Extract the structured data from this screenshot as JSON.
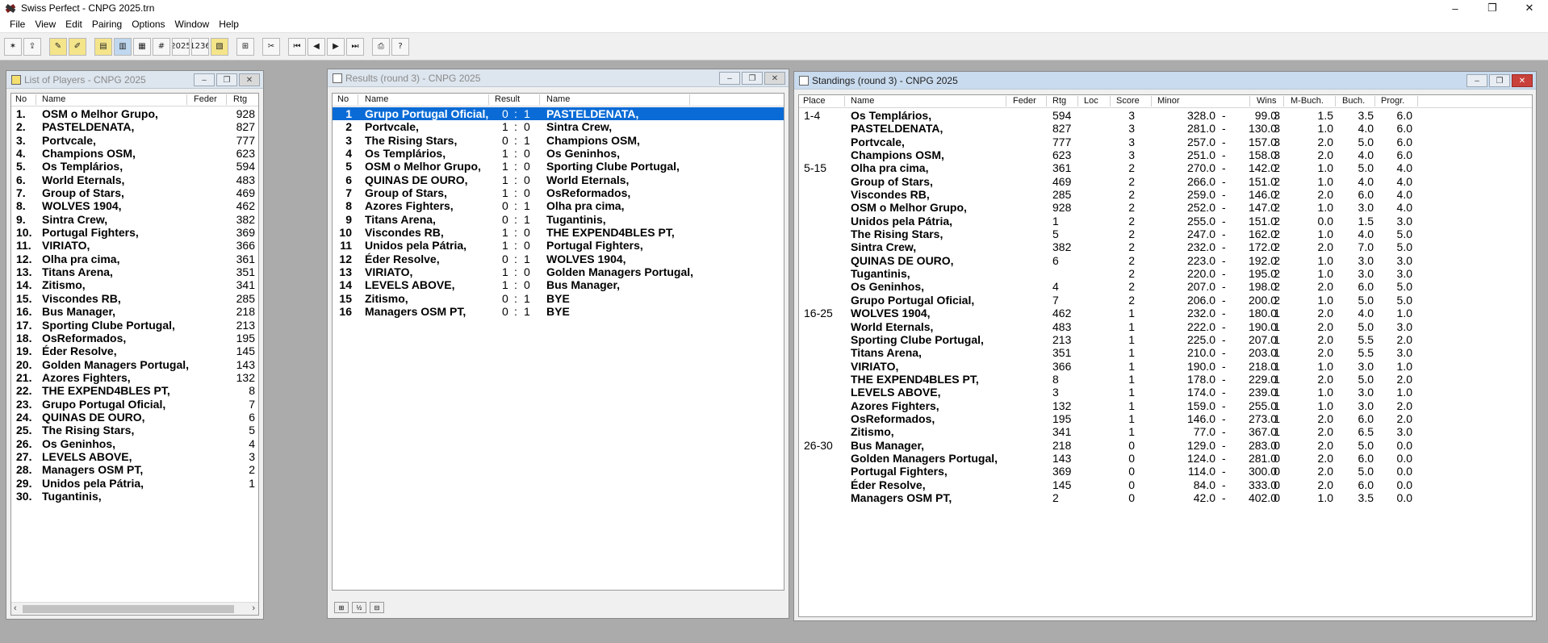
{
  "app": {
    "title": "Swiss Perfect - CNPG 2025.trn",
    "window_controls": [
      "–",
      "❐",
      "✕"
    ]
  },
  "menu": [
    "File",
    "View",
    "Edit",
    "Pairing",
    "Options",
    "Window",
    "Help"
  ],
  "toolbar": {
    "icons": [
      "new-tournament-icon",
      "open-tournament-icon",
      "sep",
      "edit-pen-icon",
      "edit-player-icon",
      "sep",
      "list-players-icon",
      "results-grid-icon",
      "grid-icon",
      "number-grid-icon",
      "year-2025-icon",
      "sort-1236-icon",
      "chart-icon",
      "sep",
      "table-icon",
      "sep",
      "scissors-icon",
      "sep",
      "first-round-icon",
      "prev-round-icon",
      "next-round-icon",
      "last-round-icon",
      "sep",
      "print-icon",
      "help-icon"
    ],
    "icon_glyphs": [
      "✶",
      "⇪",
      "",
      "✎",
      "✐",
      "",
      "▤",
      "▥",
      "▦",
      "#",
      "2025",
      "1236",
      "▧",
      "",
      "⊞",
      "",
      "✂",
      "",
      "⏮",
      "◀",
      "▶",
      "⏭",
      "",
      "⎙",
      "?"
    ]
  },
  "players_window": {
    "title": "List of Players - CNPG 2025",
    "headers": {
      "no": "No",
      "name": "Name",
      "feder": "Feder",
      "rtg": "Rtg"
    },
    "rows": [
      {
        "no": "1.",
        "name": "OSM o Melhor Grupo,",
        "rtg": "928"
      },
      {
        "no": "2.",
        "name": "PASTELDENATA,",
        "rtg": "827"
      },
      {
        "no": "3.",
        "name": "Portvcale,",
        "rtg": "777"
      },
      {
        "no": "4.",
        "name": "Champions OSM,",
        "rtg": "623"
      },
      {
        "no": "5.",
        "name": "Os Templários,",
        "rtg": "594"
      },
      {
        "no": "6.",
        "name": "World Eternals,",
        "rtg": "483"
      },
      {
        "no": "7.",
        "name": "Group of Stars,",
        "rtg": "469"
      },
      {
        "no": "8.",
        "name": "WOLVES 1904,",
        "rtg": "462"
      },
      {
        "no": "9.",
        "name": "Sintra Crew,",
        "rtg": "382"
      },
      {
        "no": "10.",
        "name": "Portugal Fighters,",
        "rtg": "369"
      },
      {
        "no": "11.",
        "name": "VIRIATO,",
        "rtg": "366"
      },
      {
        "no": "12.",
        "name": "Olha pra cima,",
        "rtg": "361"
      },
      {
        "no": "13.",
        "name": "Titans Arena,",
        "rtg": "351"
      },
      {
        "no": "14.",
        "name": "Zitismo,",
        "rtg": "341"
      },
      {
        "no": "15.",
        "name": "Viscondes RB,",
        "rtg": "285"
      },
      {
        "no": "16.",
        "name": "Bus Manager,",
        "rtg": "218"
      },
      {
        "no": "17.",
        "name": "Sporting Clube Portugal,",
        "rtg": "213"
      },
      {
        "no": "18.",
        "name": "OsReformados,",
        "rtg": "195"
      },
      {
        "no": "19.",
        "name": "Éder Resolve,",
        "rtg": "145"
      },
      {
        "no": "20.",
        "name": "Golden Managers Portugal,",
        "rtg": "143"
      },
      {
        "no": "21.",
        "name": "Azores Fighters,",
        "rtg": "132"
      },
      {
        "no": "22.",
        "name": "THE EXPEND4BLES PT,",
        "rtg": "8"
      },
      {
        "no": "23.",
        "name": "Grupo Portugal Oficial,",
        "rtg": "7"
      },
      {
        "no": "24.",
        "name": "QUINAS DE OURO,",
        "rtg": "6"
      },
      {
        "no": "25.",
        "name": "The Rising Stars,",
        "rtg": "5"
      },
      {
        "no": "26.",
        "name": "Os Geninhos,",
        "rtg": "4"
      },
      {
        "no": "27.",
        "name": "LEVELS ABOVE,",
        "rtg": "3"
      },
      {
        "no": "28.",
        "name": "Managers OSM PT,",
        "rtg": "2"
      },
      {
        "no": "29.",
        "name": "Unidos pela Pátria,",
        "rtg": "1"
      },
      {
        "no": "30.",
        "name": "Tugantinis,",
        "rtg": ""
      }
    ]
  },
  "results_window": {
    "title": "Results  (round 3) - CNPG 2025",
    "headers": {
      "no": "No",
      "name": "Name",
      "result": "Result",
      "name2": "Name"
    },
    "rows": [
      {
        "no": "1",
        "white": "Grupo Portugal Oficial,",
        "rw": "0",
        "rb": "1",
        "black": "PASTELDENATA,"
      },
      {
        "no": "2",
        "white": "Portvcale,",
        "rw": "1",
        "rb": "0",
        "black": "Sintra Crew,"
      },
      {
        "no": "3",
        "white": "The Rising Stars,",
        "rw": "0",
        "rb": "1",
        "black": "Champions OSM,"
      },
      {
        "no": "4",
        "white": "Os Templários,",
        "rw": "1",
        "rb": "0",
        "black": "Os Geninhos,"
      },
      {
        "no": "5",
        "white": "OSM o Melhor Grupo,",
        "rw": "1",
        "rb": "0",
        "black": "Sporting Clube Portugal,"
      },
      {
        "no": "6",
        "white": "QUINAS DE OURO,",
        "rw": "1",
        "rb": "0",
        "black": "World Eternals,"
      },
      {
        "no": "7",
        "white": "Group of Stars,",
        "rw": "1",
        "rb": "0",
        "black": "OsReformados,"
      },
      {
        "no": "8",
        "white": "Azores Fighters,",
        "rw": "0",
        "rb": "1",
        "black": "Olha pra cima,"
      },
      {
        "no": "9",
        "white": "Titans Arena,",
        "rw": "0",
        "rb": "1",
        "black": "Tugantinis,"
      },
      {
        "no": "10",
        "white": "Viscondes RB,",
        "rw": "1",
        "rb": "0",
        "black": "THE EXPEND4BLES PT,"
      },
      {
        "no": "11",
        "white": "Unidos pela Pátria,",
        "rw": "1",
        "rb": "0",
        "black": "Portugal Fighters,"
      },
      {
        "no": "12",
        "white": "Éder Resolve,",
        "rw": "0",
        "rb": "1",
        "black": "WOLVES 1904,"
      },
      {
        "no": "13",
        "white": "VIRIATO,",
        "rw": "1",
        "rb": "0",
        "black": "Golden Managers Portugal,"
      },
      {
        "no": "14",
        "white": "LEVELS ABOVE,",
        "rw": "1",
        "rb": "0",
        "black": "Bus Manager,"
      },
      {
        "no": "15",
        "white": "Zitismo,",
        "rw": "0",
        "rb": "1",
        "black": "BYE"
      },
      {
        "no": "16",
        "white": "Managers OSM PT,",
        "rw": "0",
        "rb": "1",
        "black": "BYE"
      }
    ],
    "bottom_buttons": [
      "⊞",
      "½",
      "⊟"
    ]
  },
  "standings_window": {
    "title": "Standings  (round 3) - CNPG 2025",
    "headers": {
      "place": "Place",
      "name": "Name",
      "feder": "Feder",
      "rtg": "Rtg",
      "loc": "Loc",
      "score": "Score",
      "minor": "Minor",
      "wins": "Wins",
      "mbuch": "M-Buch.",
      "buch": "Buch.",
      "progr": "Progr."
    },
    "rows": [
      {
        "place": "1-4",
        "name": "Os Templários,",
        "rtg": "594",
        "score": "3",
        "m1": "328.0",
        "m2": "99.0",
        "wins": "3",
        "mbuch": "1.5",
        "buch": "3.5",
        "progr": "6.0"
      },
      {
        "place": "",
        "name": "PASTELDENATA,",
        "rtg": "827",
        "score": "3",
        "m1": "281.0",
        "m2": "130.0",
        "wins": "3",
        "mbuch": "1.0",
        "buch": "4.0",
        "progr": "6.0"
      },
      {
        "place": "",
        "name": "Portvcale,",
        "rtg": "777",
        "score": "3",
        "m1": "257.0",
        "m2": "157.0",
        "wins": "3",
        "mbuch": "2.0",
        "buch": "5.0",
        "progr": "6.0"
      },
      {
        "place": "",
        "name": "Champions OSM,",
        "rtg": "623",
        "score": "3",
        "m1": "251.0",
        "m2": "158.0",
        "wins": "3",
        "mbuch": "2.0",
        "buch": "4.0",
        "progr": "6.0"
      },
      {
        "place": "5-15",
        "name": "Olha pra cima,",
        "rtg": "361",
        "score": "2",
        "m1": "270.0",
        "m2": "142.0",
        "wins": "2",
        "mbuch": "1.0",
        "buch": "5.0",
        "progr": "4.0"
      },
      {
        "place": "",
        "name": "Group of Stars,",
        "rtg": "469",
        "score": "2",
        "m1": "266.0",
        "m2": "151.0",
        "wins": "2",
        "mbuch": "1.0",
        "buch": "4.0",
        "progr": "4.0"
      },
      {
        "place": "",
        "name": "Viscondes RB,",
        "rtg": "285",
        "score": "2",
        "m1": "259.0",
        "m2": "146.0",
        "wins": "2",
        "mbuch": "2.0",
        "buch": "6.0",
        "progr": "4.0"
      },
      {
        "place": "",
        "name": "OSM o Melhor Grupo,",
        "rtg": "928",
        "score": "2",
        "m1": "252.0",
        "m2": "147.0",
        "wins": "2",
        "mbuch": "1.0",
        "buch": "3.0",
        "progr": "4.0"
      },
      {
        "place": "",
        "name": "Unidos pela Pátria,",
        "rtg": "1",
        "score": "2",
        "m1": "255.0",
        "m2": "151.0",
        "wins": "2",
        "mbuch": "0.0",
        "buch": "1.5",
        "progr": "3.0"
      },
      {
        "place": "",
        "name": "The Rising Stars,",
        "rtg": "5",
        "score": "2",
        "m1": "247.0",
        "m2": "162.0",
        "wins": "2",
        "mbuch": "1.0",
        "buch": "4.0",
        "progr": "5.0"
      },
      {
        "place": "",
        "name": "Sintra Crew,",
        "rtg": "382",
        "score": "2",
        "m1": "232.0",
        "m2": "172.0",
        "wins": "2",
        "mbuch": "2.0",
        "buch": "7.0",
        "progr": "5.0"
      },
      {
        "place": "",
        "name": "QUINAS DE OURO,",
        "rtg": "6",
        "score": "2",
        "m1": "223.0",
        "m2": "192.0",
        "wins": "2",
        "mbuch": "1.0",
        "buch": "3.0",
        "progr": "3.0"
      },
      {
        "place": "",
        "name": "Tugantinis,",
        "rtg": "",
        "score": "2",
        "m1": "220.0",
        "m2": "195.0",
        "wins": "2",
        "mbuch": "1.0",
        "buch": "3.0",
        "progr": "3.0"
      },
      {
        "place": "",
        "name": "Os Geninhos,",
        "rtg": "4",
        "score": "2",
        "m1": "207.0",
        "m2": "198.0",
        "wins": "2",
        "mbuch": "2.0",
        "buch": "6.0",
        "progr": "5.0"
      },
      {
        "place": "",
        "name": "Grupo Portugal Oficial,",
        "rtg": "7",
        "score": "2",
        "m1": "206.0",
        "m2": "200.0",
        "wins": "2",
        "mbuch": "1.0",
        "buch": "5.0",
        "progr": "5.0"
      },
      {
        "place": "16-25",
        "name": "WOLVES 1904,",
        "rtg": "462",
        "score": "1",
        "m1": "232.0",
        "m2": "180.0",
        "wins": "1",
        "mbuch": "2.0",
        "buch": "4.0",
        "progr": "1.0"
      },
      {
        "place": "",
        "name": "World Eternals,",
        "rtg": "483",
        "score": "1",
        "m1": "222.0",
        "m2": "190.0",
        "wins": "1",
        "mbuch": "2.0",
        "buch": "5.0",
        "progr": "3.0"
      },
      {
        "place": "",
        "name": "Sporting Clube Portugal,",
        "rtg": "213",
        "score": "1",
        "m1": "225.0",
        "m2": "207.0",
        "wins": "1",
        "mbuch": "2.0",
        "buch": "5.5",
        "progr": "2.0"
      },
      {
        "place": "",
        "name": "Titans Arena,",
        "rtg": "351",
        "score": "1",
        "m1": "210.0",
        "m2": "203.0",
        "wins": "1",
        "mbuch": "2.0",
        "buch": "5.5",
        "progr": "3.0"
      },
      {
        "place": "",
        "name": "VIRIATO,",
        "rtg": "366",
        "score": "1",
        "m1": "190.0",
        "m2": "218.0",
        "wins": "1",
        "mbuch": "1.0",
        "buch": "3.0",
        "progr": "1.0"
      },
      {
        "place": "",
        "name": "THE EXPEND4BLES PT,",
        "rtg": "8",
        "score": "1",
        "m1": "178.0",
        "m2": "229.0",
        "wins": "1",
        "mbuch": "2.0",
        "buch": "5.0",
        "progr": "2.0"
      },
      {
        "place": "",
        "name": "LEVELS ABOVE,",
        "rtg": "3",
        "score": "1",
        "m1": "174.0",
        "m2": "239.0",
        "wins": "1",
        "mbuch": "1.0",
        "buch": "3.0",
        "progr": "1.0"
      },
      {
        "place": "",
        "name": "Azores Fighters,",
        "rtg": "132",
        "score": "1",
        "m1": "159.0",
        "m2": "255.0",
        "wins": "1",
        "mbuch": "1.0",
        "buch": "3.0",
        "progr": "2.0"
      },
      {
        "place": "",
        "name": "OsReformados,",
        "rtg": "195",
        "score": "1",
        "m1": "146.0",
        "m2": "273.0",
        "wins": "1",
        "mbuch": "2.0",
        "buch": "6.0",
        "progr": "2.0"
      },
      {
        "place": "",
        "name": "Zitismo,",
        "rtg": "341",
        "score": "1",
        "m1": "77.0",
        "m2": "367.0",
        "wins": "1",
        "mbuch": "2.0",
        "buch": "6.5",
        "progr": "3.0"
      },
      {
        "place": "26-30",
        "name": "Bus Manager,",
        "rtg": "218",
        "score": "0",
        "m1": "129.0",
        "m2": "283.0",
        "wins": "0",
        "mbuch": "2.0",
        "buch": "5.0",
        "progr": "0.0"
      },
      {
        "place": "",
        "name": "Golden Managers Portugal,",
        "rtg": "143",
        "score": "0",
        "m1": "124.0",
        "m2": "281.0",
        "wins": "0",
        "mbuch": "2.0",
        "buch": "6.0",
        "progr": "0.0"
      },
      {
        "place": "",
        "name": "Portugal Fighters,",
        "rtg": "369",
        "score": "0",
        "m1": "114.0",
        "m2": "300.0",
        "wins": "0",
        "mbuch": "2.0",
        "buch": "5.0",
        "progr": "0.0"
      },
      {
        "place": "",
        "name": "Éder Resolve,",
        "rtg": "145",
        "score": "0",
        "m1": "84.0",
        "m2": "333.0",
        "wins": "0",
        "mbuch": "2.0",
        "buch": "6.0",
        "progr": "0.0"
      },
      {
        "place": "",
        "name": "Managers OSM PT,",
        "rtg": "2",
        "score": "0",
        "m1": "42.0",
        "m2": "402.0",
        "wins": "0",
        "mbuch": "1.0",
        "buch": "3.5",
        "progr": "0.0"
      }
    ],
    "minor_separator": "-"
  },
  "mdi_controls": [
    "–",
    "❐",
    "✕"
  ],
  "scroll_arrows": {
    "left": "‹",
    "right": "›"
  },
  "colors": {
    "selection": "#0a6bd6",
    "workspace": "#ababab",
    "active_close": "#c8413a"
  }
}
